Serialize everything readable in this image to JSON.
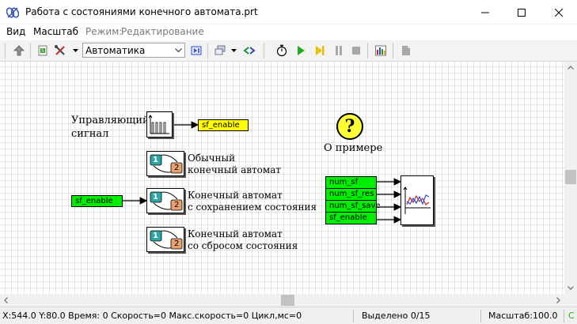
{
  "window": {
    "title": "Работа с состояниями конечного автомата.prt"
  },
  "menu": {
    "view": "Вид",
    "scale": "Масштаб",
    "mode_label": "Режим:",
    "mode_value": "Редактирование"
  },
  "toolbar": {
    "combo_value": "Автоматика"
  },
  "canvas": {
    "control_signal_line1": "Управляющий",
    "control_signal_line2": "сигнал",
    "sf_enable_out": "sf_enable",
    "sf_enable_in": "sf_enable",
    "fsm1_line1": "Обычный",
    "fsm1_line2": "конечный автомат",
    "fsm2_line1": "Конечный автомат",
    "fsm2_line2": "с сохранением состояния",
    "fsm3_line1": "Конечный автомат",
    "fsm3_line2": "со сбросом состояния",
    "about_label": "О примере",
    "about_symbol": "?",
    "fsm_state1": "1",
    "fsm_state2": "2",
    "plot_ports": [
      "num_sf",
      "num_sf_res",
      "num_sf_save",
      "sf_enable"
    ]
  },
  "status": {
    "coords": "X:544.0  Y:80.0 Время: 0 Скорость=0 Макс.скорость=0 Цикл,мс=0",
    "selected": "Выделено 0/15",
    "scale": "Масштаб:100.0",
    "extra": "С"
  },
  "colors": {
    "port_yellow": "#ffff00",
    "port_green": "#00ee00",
    "about_yellow": "#ffff33",
    "play_green": "#22aa22",
    "step_yellow": "#e8c000"
  }
}
